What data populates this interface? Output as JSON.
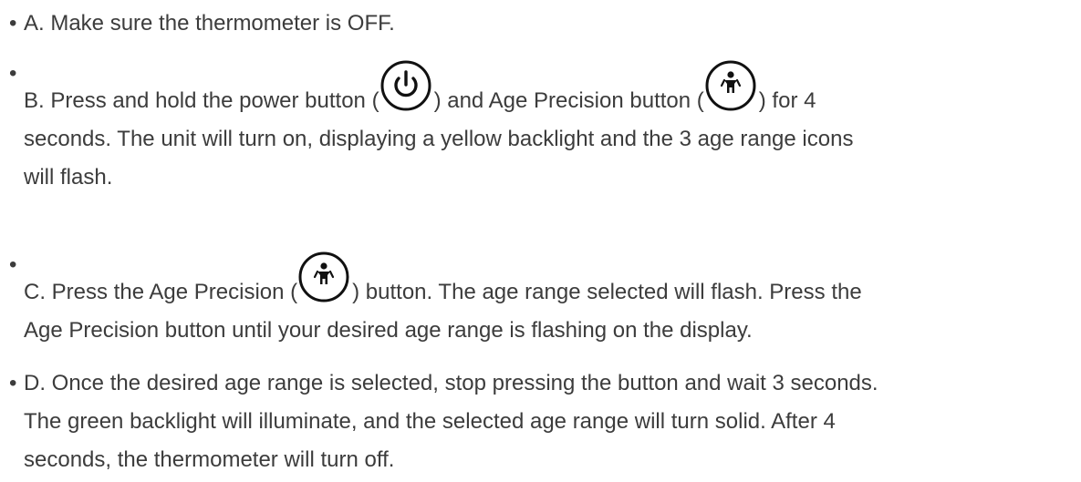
{
  "bullet": "•",
  "steps": {
    "a": {
      "text": "A. Make sure the thermometer is OFF."
    },
    "b": {
      "before_power": "B. Press and hold the power button (",
      "between_icons": ") and Age Precision button (",
      "after_age": ") for 4",
      "line2": "seconds. The unit will turn on, displaying a yellow backlight and the 3 age range icons",
      "line3": "will flash."
    },
    "c": {
      "before_age": "C. Press the Age Precision (",
      "after_age": ") button. The age range selected will flash. Press the",
      "line2": "Age Precision button until your desired age range is flashing on the display."
    },
    "d": {
      "line1": "D. Once the desired age range is selected, stop pressing the button and wait 3 seconds.",
      "line2": "The green backlight will illuminate, and the selected age range will turn solid. After 4",
      "line3": "seconds, the thermometer will turn off."
    }
  },
  "icons": {
    "power": "power-icon",
    "age_precision": "child-icon"
  },
  "colors": {
    "text": "#3c3c3c",
    "icon_stroke": "#111111"
  }
}
